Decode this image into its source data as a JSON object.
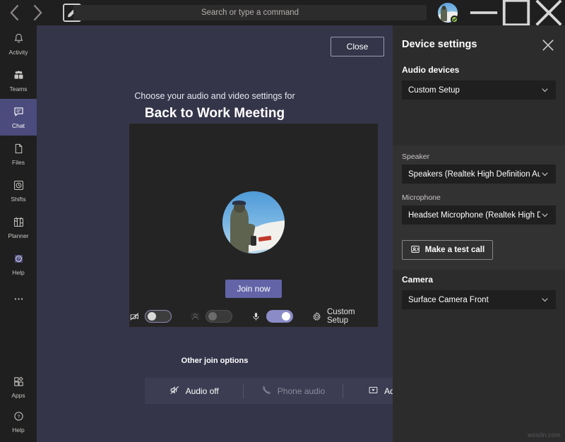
{
  "titlebar": {
    "back_icon": "chevron-left-icon",
    "forward_icon": "chevron-right-icon",
    "compose_icon": "compose-icon",
    "search_placeholder": "Search or type a command",
    "avatar_name": "user-avatar",
    "presence": "available",
    "minimize_label": "–",
    "maximize_label": "□",
    "close_label": "✕"
  },
  "rail": {
    "items": [
      {
        "label": "Activity",
        "icon": "bell-icon",
        "active": false
      },
      {
        "label": "Teams",
        "icon": "people-icon",
        "active": false
      },
      {
        "label": "Chat",
        "icon": "chat-icon",
        "active": true
      },
      {
        "label": "Files",
        "icon": "file-icon",
        "active": false
      },
      {
        "label": "Shifts",
        "icon": "clock-icon",
        "active": false
      },
      {
        "label": "Planner",
        "icon": "planner-icon",
        "active": false
      },
      {
        "label": "Help",
        "icon": "help-circle-icon",
        "active": false
      },
      {
        "label": "",
        "icon": "more-ellipsis-icon",
        "active": false
      }
    ],
    "bottom": [
      {
        "label": "Apps",
        "icon": "apps-icon"
      },
      {
        "label": "Help",
        "icon": "help-circle-icon"
      }
    ]
  },
  "stage": {
    "close_button": "Close",
    "subtitle": "Choose your audio and video settings for",
    "meeting_title": "Back to Work Meeting",
    "join_button": "Join now",
    "controls": {
      "camera_icon": "camera-off-icon",
      "camera_toggle_state": "off",
      "background_blur_icon": "background-blur-icon",
      "background_blur_state": "disabled",
      "mic_icon": "microphone-icon",
      "mic_toggle_state": "on",
      "device_settings_icon": "gear-icon",
      "device_settings_label": "Custom Setup"
    },
    "other_join_options_label": "Other join options",
    "join_options": [
      {
        "label": "Audio off",
        "icon": "speaker-mute-icon",
        "disabled": false
      },
      {
        "label": "Phone audio",
        "icon": "phone-icon",
        "disabled": true
      },
      {
        "label": "Add a ro",
        "icon": "add-room-icon",
        "disabled": false
      }
    ]
  },
  "device_panel": {
    "title": "Device settings",
    "close_icon": "close-icon",
    "audio_devices_label": "Audio devices",
    "audio_devices_value": "Custom Setup",
    "speaker_label": "Speaker",
    "speaker_value": "Speakers (Realtek High Definition Au...",
    "microphone_label": "Microphone",
    "microphone_value": "Headset Microphone (Realtek High D...",
    "test_call_label": "Make a test call",
    "test_call_icon": "test-call-icon",
    "camera_label": "Camera",
    "camera_value": "Surface Camera Front"
  },
  "watermark": "wsxdn.com",
  "colors": {
    "accent": "#6264a7",
    "stage_bg": "#35354a",
    "panel_bg": "#2d2c2c",
    "rail_bg": "#1f1f1f",
    "titlebar_bg": "#201f1f",
    "presence_green": "#92c353",
    "toggle_on": "#8b8cc7"
  }
}
